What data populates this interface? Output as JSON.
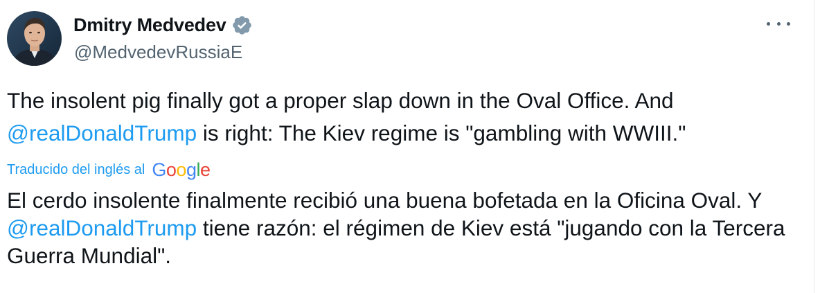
{
  "author": {
    "display_name": "Dmitry Medvedev",
    "handle": "@MedvedevRussiaE",
    "verified": true,
    "verified_icon": "verified-badge-icon",
    "badge_color": "#829aab"
  },
  "menu": {
    "icon": "more-options-icon"
  },
  "tweet": {
    "original": {
      "part1": "The insolent pig finally got a proper slap down in the Oval Office. And ",
      "mention": "@realDonaldTrump",
      "part2": " is right: The Kiev regime is \"gambling with WWIII.\""
    },
    "translation_label": "Traducido del inglés al",
    "translation_provider": {
      "letters": [
        "G",
        "o",
        "o",
        "g",
        "l",
        "e"
      ]
    },
    "translation": {
      "part1": "El cerdo insolente finalmente recibió una buena bofetada en la Oficina Oval. Y ",
      "mention": "@realDonaldTrump",
      "part2": " tiene razón: el régimen de Kiev está \"jugando con la Tercera Guerra Mundial\"."
    }
  },
  "colors": {
    "link": "#1d9bf0",
    "text": "#0f1419",
    "secondary": "#536471"
  }
}
